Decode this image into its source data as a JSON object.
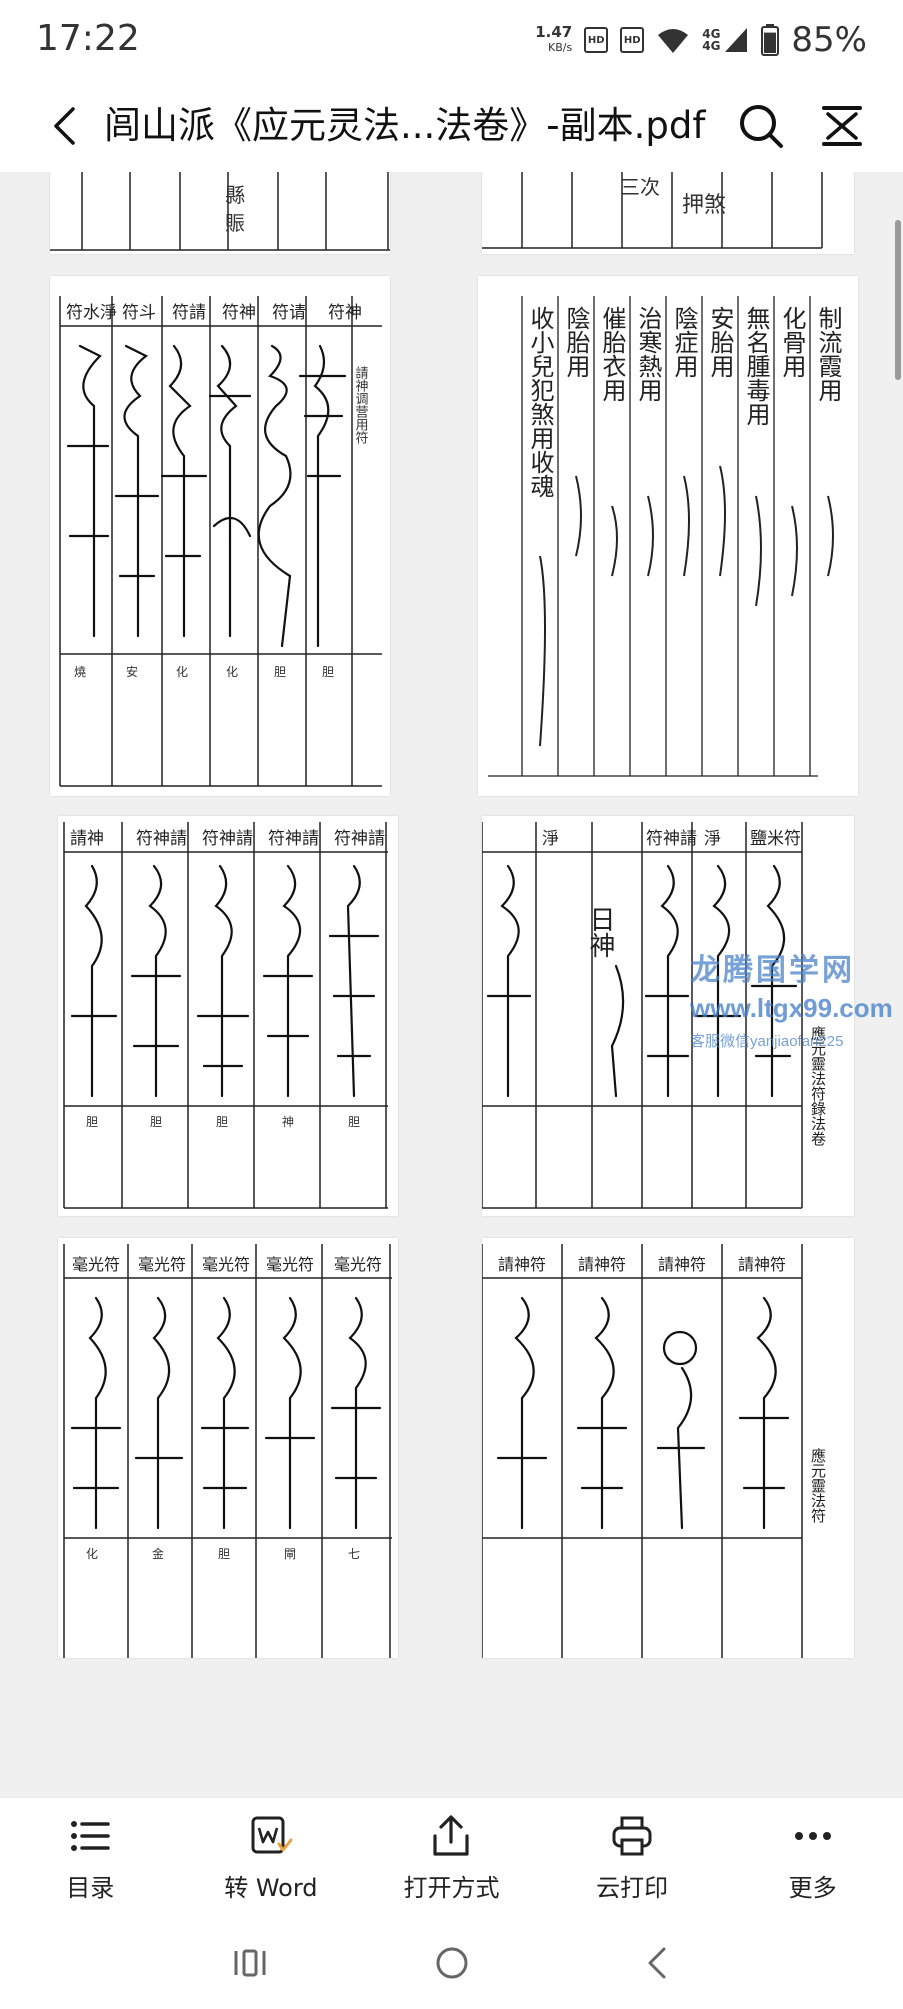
{
  "status_bar": {
    "time": "17:22",
    "net_speed_value": "1.47",
    "net_speed_unit": "KB/s",
    "sim1": "HD",
    "sim2": "HD",
    "signal1": "4G",
    "signal2": "4G",
    "battery": "85%",
    "battery_level": 0.85
  },
  "header": {
    "title": "闾山派《应元灵法...法卷》-副本.pdf",
    "back_icon": "chevron-left-icon",
    "search_icon": "search-icon",
    "fit_icon": "fit-width-icon"
  },
  "document": {
    "pages": [
      {
        "texts": [
          "三次",
          "押煞"
        ]
      },
      {
        "texts": [
          "請神调营用符",
          "符神",
          "符请",
          "符神",
          "符請",
          "符斗",
          "符水淨"
        ]
      },
      {
        "texts": [
          "制流霞用",
          "化骨用",
          "無名腫毒用",
          "安胎用",
          "陰症用",
          "治寒熱用",
          "催胎衣用",
          "陰胎用",
          "收小兒犯煞用收魂"
        ]
      },
      {
        "texts": [
          "請神",
          "符神請",
          "符神請",
          "符神請",
          "符神請"
        ]
      },
      {
        "texts": [
          "鹽米符",
          "淨",
          "符神請",
          "日神",
          "淨",
          "應元靈法符錄法卷"
        ]
      },
      {
        "texts": [
          "毫光符",
          "毫光符",
          "毫光符",
          "毫光符",
          "毫光符"
        ]
      },
      {
        "texts": [
          "請神符",
          "請神符",
          "請神符",
          "請神符",
          "應元靈法符"
        ]
      }
    ],
    "watermark": {
      "line1": "龙腾国学网",
      "line2": "www.ltgx99.com",
      "line3": "客服微信yanjiaofan225"
    }
  },
  "toolbar": {
    "items": [
      {
        "label": "目录",
        "icon": "list-icon"
      },
      {
        "label": "转 Word",
        "icon": "convert-word-icon"
      },
      {
        "label": "打开方式",
        "icon": "share-icon"
      },
      {
        "label": "云打印",
        "icon": "printer-icon"
      },
      {
        "label": "更多",
        "icon": "more-dots-icon"
      }
    ]
  },
  "nav_bar": {
    "recent_icon": "recent-apps-icon",
    "home_icon": "home-icon",
    "back_icon": "nav-back-icon"
  }
}
